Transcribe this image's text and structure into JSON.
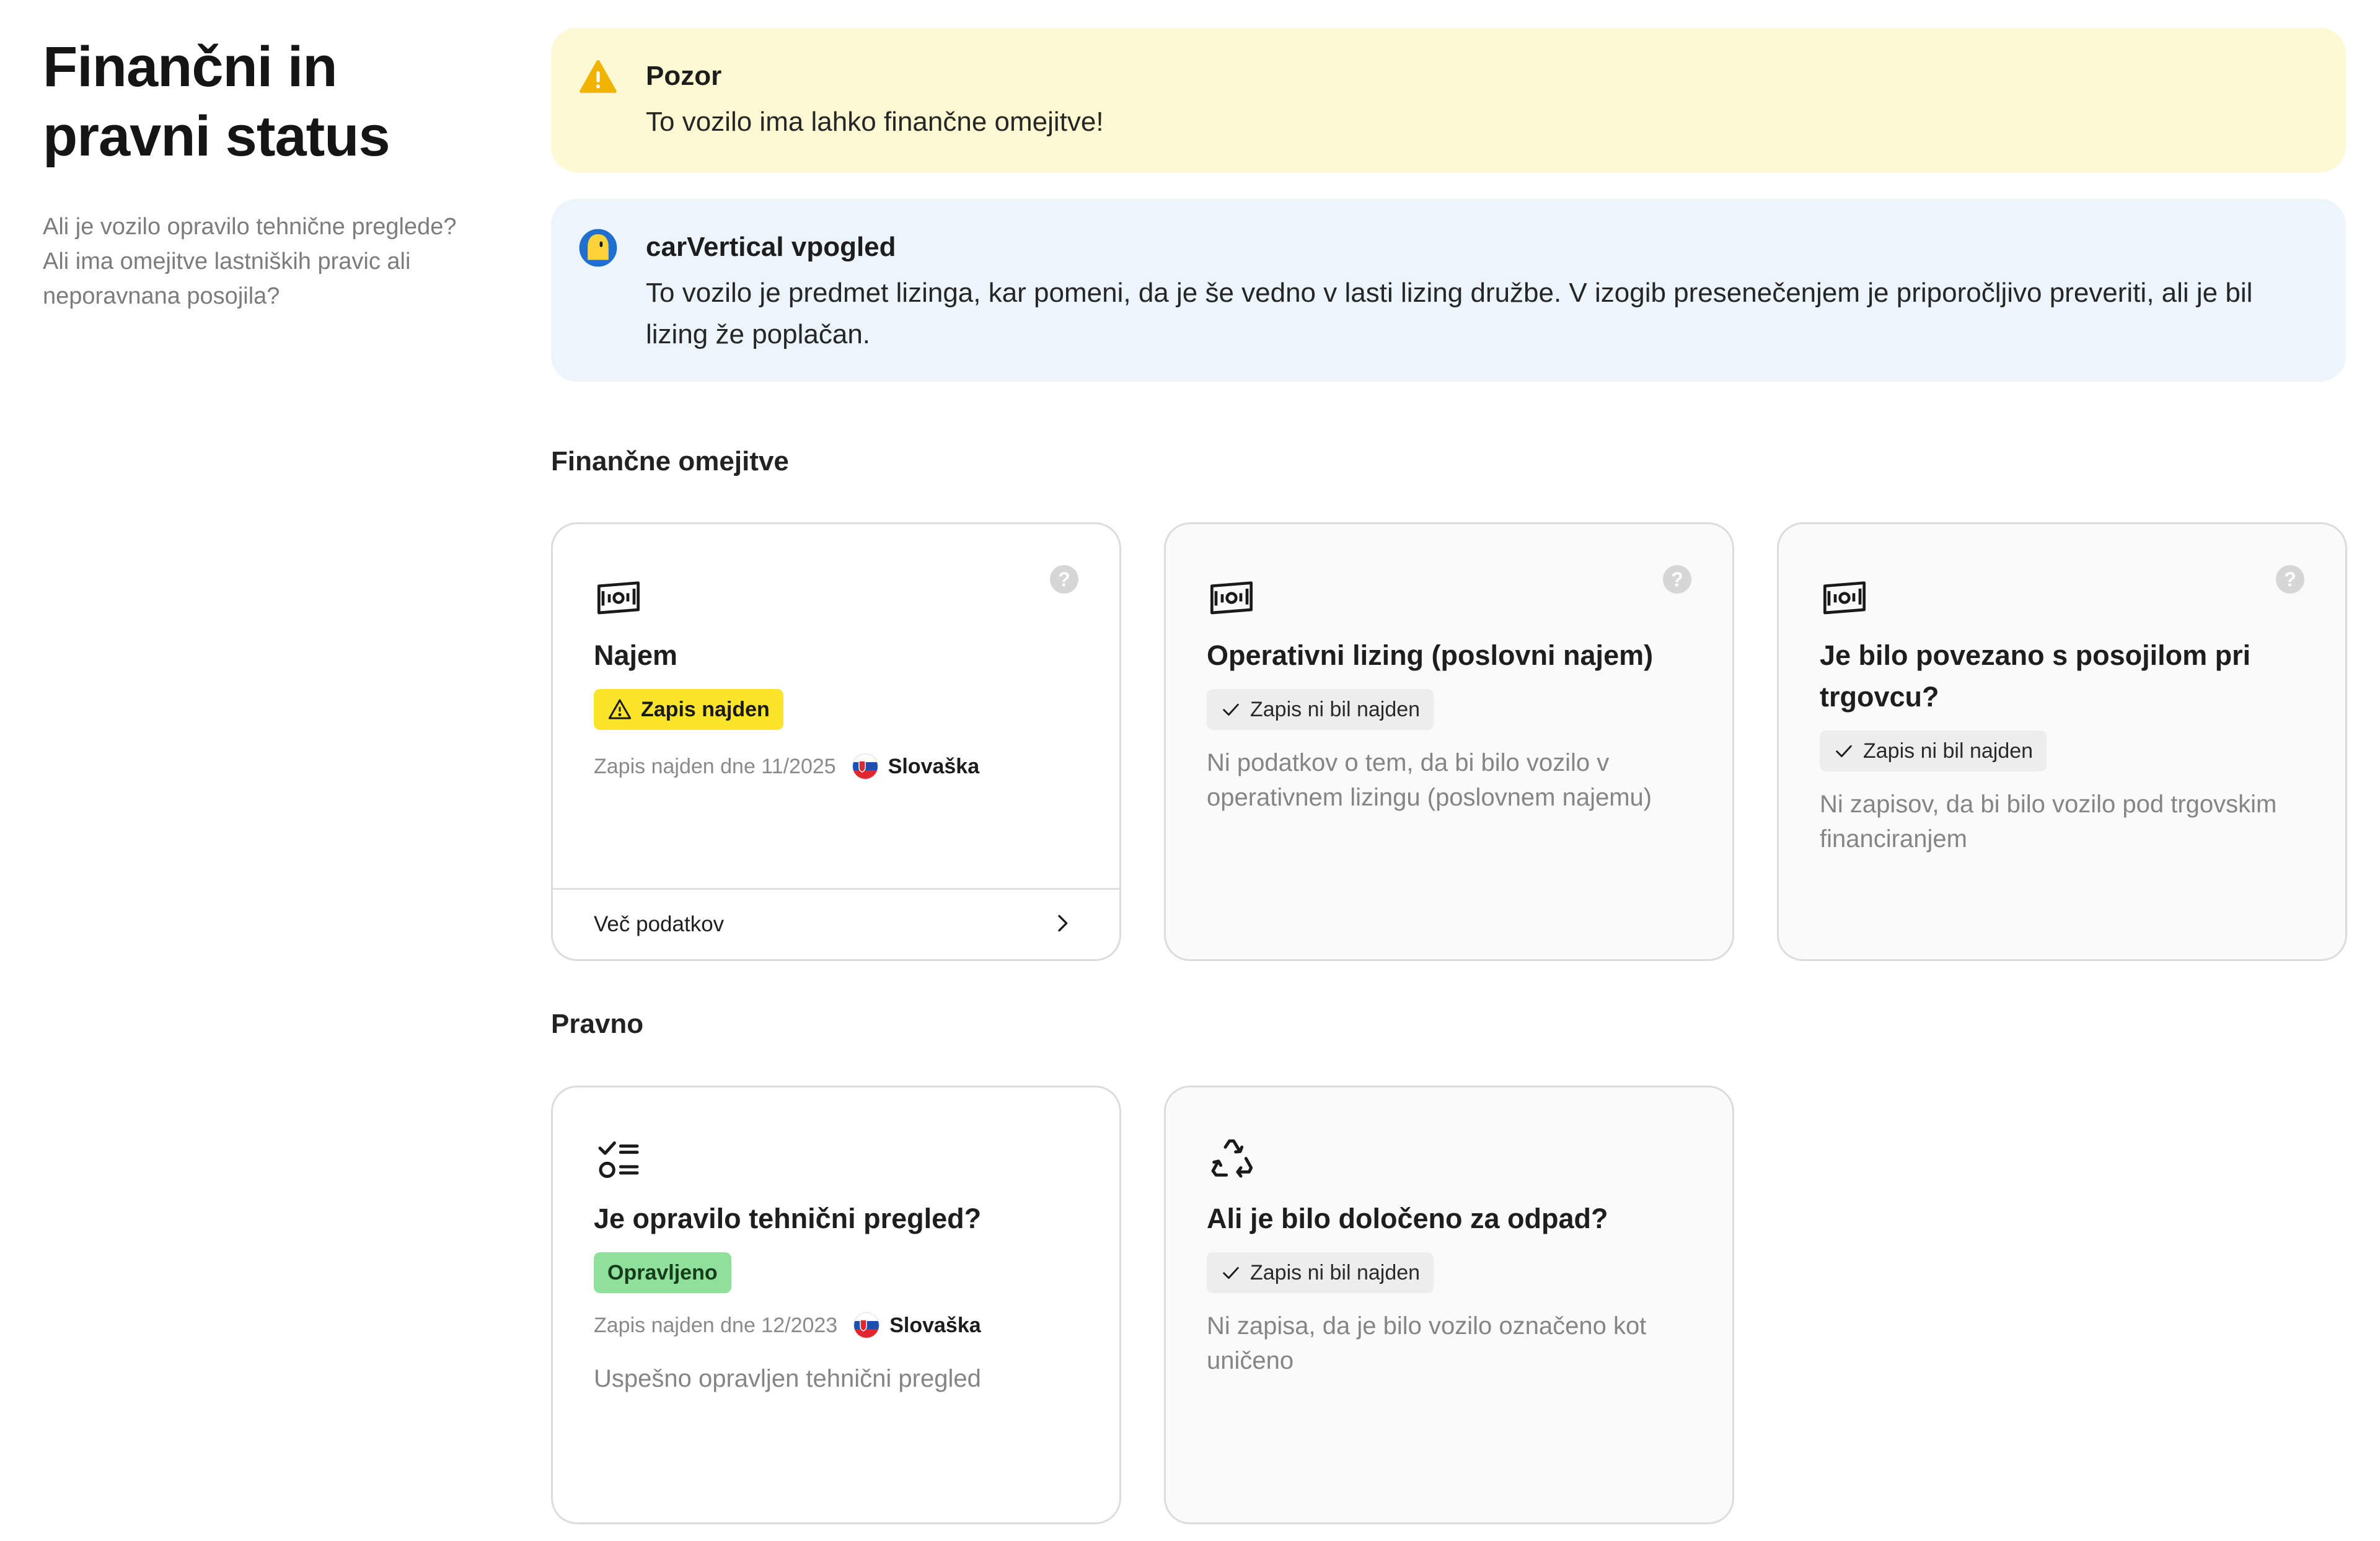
{
  "sidebar": {
    "title_line1": "Finančni in",
    "title_line2": "pravni status",
    "description": "Ali je vozilo opravilo tehnične preglede? Ali ima omejitve lastniških pravic ali neporavnana posojila?"
  },
  "alerts": {
    "warning": {
      "title": "Pozor",
      "text": "To vozilo ima lahko finančne omejitve!"
    },
    "insight": {
      "title": "carVertical vpogled",
      "text": "To vozilo je predmet lizinga, kar pomeni, da je še vedno v lasti lizing družbe. V izogib presenečenjem je priporočljivo preveriti, ali je bil lizing že poplačan."
    }
  },
  "sections": {
    "financial": "Finančne omejitve",
    "legal": "Pravno"
  },
  "cards": {
    "lease": {
      "title": "Najem",
      "badge": "Zapis najden",
      "meta": "Zapis najden dne 11/2025",
      "country": "Slovaška",
      "footer": "Več podatkov"
    },
    "operational": {
      "title": "Operativni lizing (poslovni najem)",
      "badge": "Zapis ni bil najden",
      "desc": "Ni podatkov o tem, da bi bilo vozilo v operativnem lizingu (poslovnem najemu)"
    },
    "dealer": {
      "title": "Je bilo povezano s posojilom pri trgovcu?",
      "badge": "Zapis ni bil najden",
      "desc": "Ni zapisov, da bi bilo vozilo pod trgovskim financiranjem"
    },
    "inspection": {
      "title": "Je opravilo tehnični pregled?",
      "badge": "Opravljeno",
      "meta": "Zapis najden dne 12/2023",
      "country": "Slovaška",
      "desc": "Uspešno opravljen tehnični pregled"
    },
    "scrap": {
      "title": "Ali je bilo določeno za odpad?",
      "badge": "Zapis ni bil najden",
      "desc": "Ni zapisa, da je bilo vozilo označeno kot uničeno"
    }
  },
  "help_glyph": "?",
  "colors": {
    "warning_bg": "#fdf9d3",
    "info_bg": "#ecf4fc",
    "badge_yellow": "#fbe42a",
    "badge_green": "#8fe09a",
    "warning_icon": "#f0b400"
  },
  "icons": [
    "warning-icon",
    "carvertical-logo-icon",
    "banknote-icon",
    "help-icon",
    "check-icon",
    "checklist-icon",
    "recycle-icon",
    "chevron-right-icon",
    "slovakia-flag-icon"
  ]
}
